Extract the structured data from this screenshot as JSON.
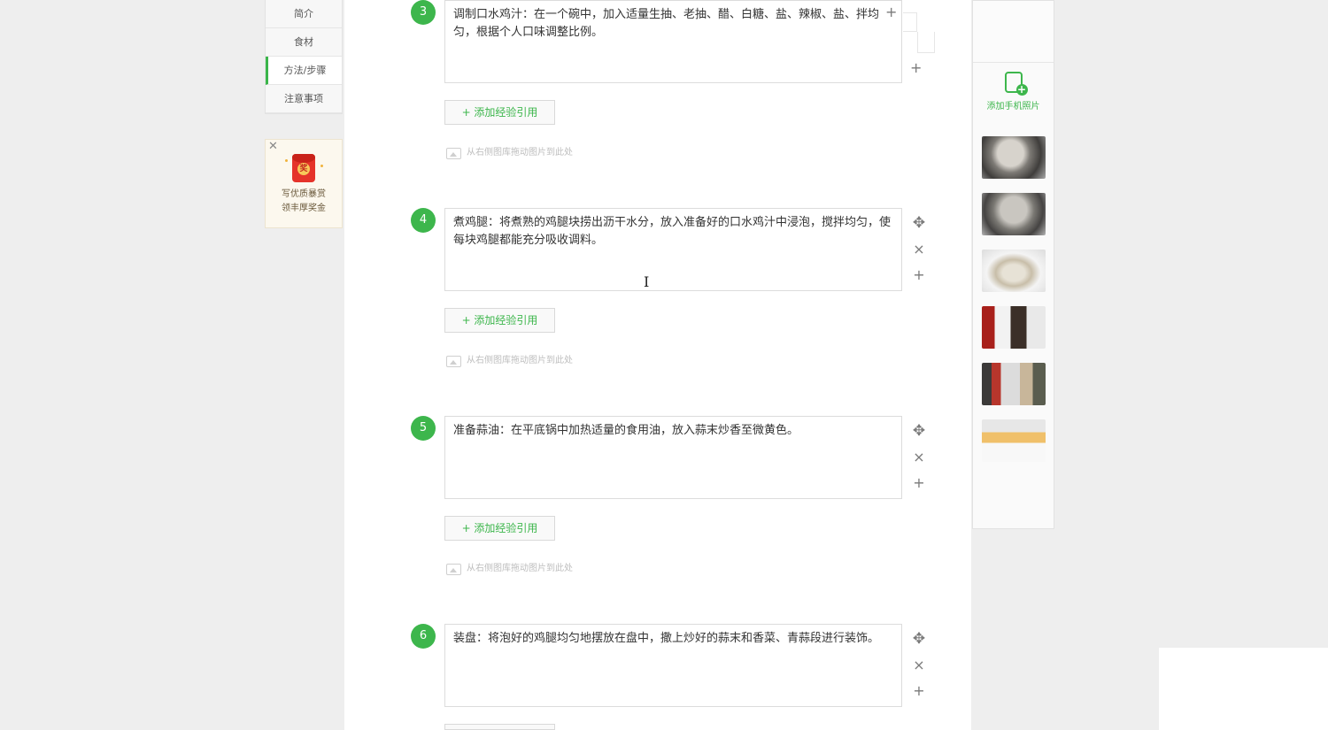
{
  "left_nav": {
    "items": [
      "简介",
      "食材",
      "方法/步骤",
      "注意事项"
    ]
  },
  "promo": {
    "badge": "奖",
    "line1": "写优质暴赏",
    "line2": "领丰厚奖金"
  },
  "steps": [
    {
      "number": "3",
      "text": "调制口水鸡汁：在一个碗中，加入适量生抽、老抽、醋、白糖、盐、辣椒、盐、拌均匀，根据个人口味调整比例。"
    },
    {
      "number": "4",
      "text": "煮鸡腿：将煮熟的鸡腿块捞出沥干水分，放入准备好的口水鸡汁中浸泡，搅拌均匀，使每块鸡腿都能充分吸收调料。"
    },
    {
      "number": "5",
      "text": "准备蒜油：在平底锅中加热适量的食用油，放入蒜末炒香至微黄色。"
    },
    {
      "number": "6",
      "text": "装盘：将泡好的鸡腿均匀地摆放在盘中，撒上炒好的蒜末和香菜、青蒜段进行装饰。"
    }
  ],
  "step_tools": {
    "move": "✥",
    "delete": "×",
    "add": "+"
  },
  "add_experience_label": "+ 添加经验引用",
  "drop_hint": "从右侧图库拖动图片到此处",
  "right_panel": {
    "add_phone_label": "添加手机照片",
    "thumbnails": [
      "boiled-chicken-pot-photo",
      "chicken-in-pot-photo",
      "sliced-chicken-plate-photo",
      "sauce-bottles-bowl-photo",
      "ingredients-bottles-photo",
      "plated-chicken-photo"
    ]
  },
  "colors": {
    "accent": "#3db64c",
    "background": "#eeeeee",
    "panel": "#ffffff"
  }
}
